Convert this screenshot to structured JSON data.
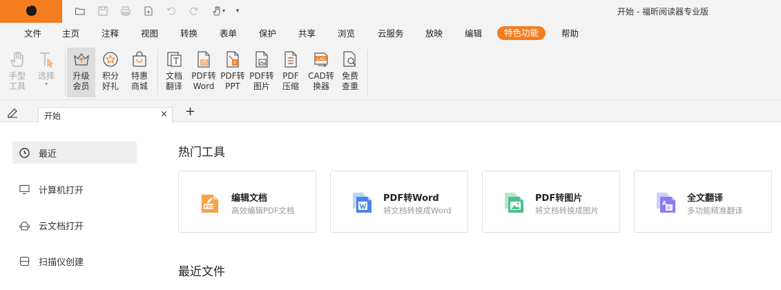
{
  "app": {
    "title": "开始 - 福昕阅读器专业版",
    "brand_color": "#f47d20"
  },
  "menu": {
    "items": [
      "文件",
      "主页",
      "注释",
      "视图",
      "转换",
      "表单",
      "保护",
      "共享",
      "浏览",
      "云服务",
      "放映",
      "编辑",
      "特色功能",
      "帮助"
    ],
    "active": "特色功能"
  },
  "ribbon": {
    "buttons": [
      {
        "label": "手型\n工具",
        "icon": "hand-icon"
      },
      {
        "label": "选择",
        "icon": "select-cursor-icon"
      },
      {
        "label": "升级\n会员",
        "icon": "upgrade-crown-icon"
      },
      {
        "label": "积分\n好礼",
        "icon": "points-star-icon"
      },
      {
        "label": "特惠\n商城",
        "icon": "shopping-bag-icon"
      },
      {
        "label": "文档\n翻译",
        "icon": "document-translate-icon"
      },
      {
        "label": "PDF转\nWord",
        "icon": "pdf-to-word-icon"
      },
      {
        "label": "PDF转\nPPT",
        "icon": "pdf-to-ppt-icon"
      },
      {
        "label": "PDF转\n图片",
        "icon": "pdf-to-image-icon"
      },
      {
        "label": "PDF\n压缩",
        "icon": "pdf-compress-icon"
      },
      {
        "label": "CAD转\n换器",
        "icon": "cad-converter-icon"
      },
      {
        "label": "免费\n查重",
        "icon": "plagiarism-check-icon"
      }
    ]
  },
  "tabs": {
    "items": [
      {
        "label": "开始"
      }
    ],
    "close_glyph": "×",
    "add_glyph": "+"
  },
  "sidebar": {
    "items": [
      {
        "label": "最近",
        "icon": "clock-icon"
      },
      {
        "label": "计算机打开",
        "icon": "computer-icon"
      },
      {
        "label": "云文档打开",
        "icon": "cloud-doc-icon"
      },
      {
        "label": "扫描仪创建",
        "icon": "scanner-icon"
      }
    ],
    "active": "最近"
  },
  "main": {
    "hot_tools_title": "热门工具",
    "recent_files_title": "最近文件",
    "cards": [
      {
        "title": "编辑文档",
        "desc": "高效编辑PDF文档",
        "icon": "edit-document-icon",
        "color": "#f5a24b"
      },
      {
        "title": "PDF转Word",
        "desc": "将文档转换成Word",
        "icon": "pdf-to-word-icon",
        "color": "#4a86e8"
      },
      {
        "title": "PDF转图片",
        "desc": "将文档转换成图片",
        "icon": "pdf-to-image-icon",
        "color": "#4cc08a"
      },
      {
        "title": "全文翻译",
        "desc": "多功能精准翻译",
        "icon": "translate-icon",
        "color": "#8b7df0"
      }
    ]
  }
}
